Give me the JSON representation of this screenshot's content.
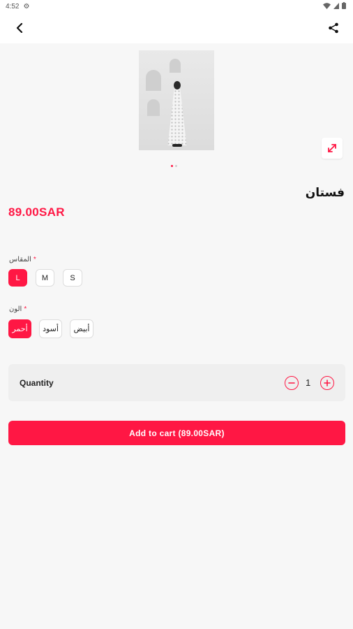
{
  "status_bar": {
    "time": "4:52"
  },
  "product": {
    "title": "فستان",
    "price": "89.00SAR",
    "image_count": 2
  },
  "options": {
    "size": {
      "label": "المقاس",
      "required_mark": "*",
      "values": [
        "L",
        "M",
        "S"
      ],
      "selected": "L"
    },
    "color": {
      "label": "الون",
      "required_mark": "*",
      "values": [
        "أحمر",
        "أسود",
        "أبيض"
      ],
      "selected": "أحمر"
    }
  },
  "quantity": {
    "label": "Quantity",
    "value": "1"
  },
  "cart": {
    "button_label": "Add to cart (89.00SAR)"
  },
  "colors": {
    "accent": "#ff1744",
    "background": "#f7f7f7"
  },
  "icons": [
    "back-arrow-icon",
    "share-icon",
    "expand-icon",
    "minus-circle-icon",
    "plus-circle-icon",
    "settings-icon",
    "wifi-icon",
    "battery-icon"
  ]
}
